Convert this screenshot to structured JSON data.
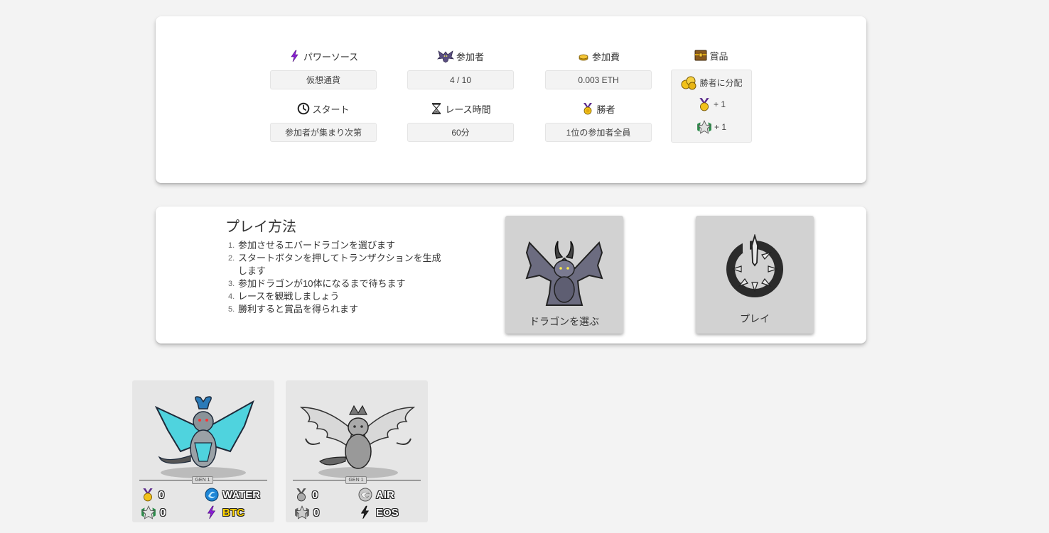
{
  "race_info": {
    "power_source": {
      "label": "パワーソース",
      "value": "仮想通貨",
      "icon": "lightning-icon"
    },
    "participants": {
      "label": "参加者",
      "value": "4 / 10",
      "icon": "bat-dragon-icon"
    },
    "entry_fee": {
      "label": "参加費",
      "value": "0.003 ETH",
      "icon": "coin-icon"
    },
    "start": {
      "label": "スタート",
      "value": "参加者が集まり次第",
      "icon": "clock-icon"
    },
    "race_time": {
      "label": "レース時間",
      "value": "60分",
      "icon": "hourglass-icon"
    },
    "winner": {
      "label": "勝者",
      "value": "1位の参加者全員",
      "icon": "medal-icon"
    },
    "prize": {
      "label": "賞品",
      "distribution": "勝者に分配",
      "items": [
        {
          "icon": "gold-medal-icon",
          "text": "+ 1"
        },
        {
          "icon": "star-badge-icon",
          "text": "+ 1"
        }
      ]
    }
  },
  "howto": {
    "title": "プレイ方法",
    "steps": [
      {
        "num": "1.",
        "text": "参加させるエバードラゴンを選びます"
      },
      {
        "num": "2.",
        "text": "スタートボタンを押してトランザクションを生成します"
      },
      {
        "num": "3.",
        "text": "参加ドラゴンが10体になるまで待ちます"
      },
      {
        "num": "4.",
        "text": "レースを観戦しましょう"
      },
      {
        "num": "5.",
        "text": "勝利すると賞品を得られます"
      }
    ],
    "select_dragon_label": "ドラゴンを選ぶ",
    "play_label": "プレイ"
  },
  "dragons": [
    {
      "gen": "GEN 1",
      "medals": "0",
      "stars": "0",
      "element": "WATER",
      "power": "BTC",
      "colors": {
        "wing": "#4fd3de",
        "body": "#9aa1a6"
      }
    },
    {
      "gen": "GEN 1",
      "medals": "0",
      "stars": "0",
      "element": "AIR",
      "power": "EOS",
      "colors": {
        "wing": "#d8d8d8",
        "body": "#aaaaaa"
      }
    }
  ],
  "colors": {
    "background": "#f3f3f3",
    "button": "#d2d2d2",
    "lightning": "#8b1fd6",
    "gold": "#e8c21c"
  }
}
